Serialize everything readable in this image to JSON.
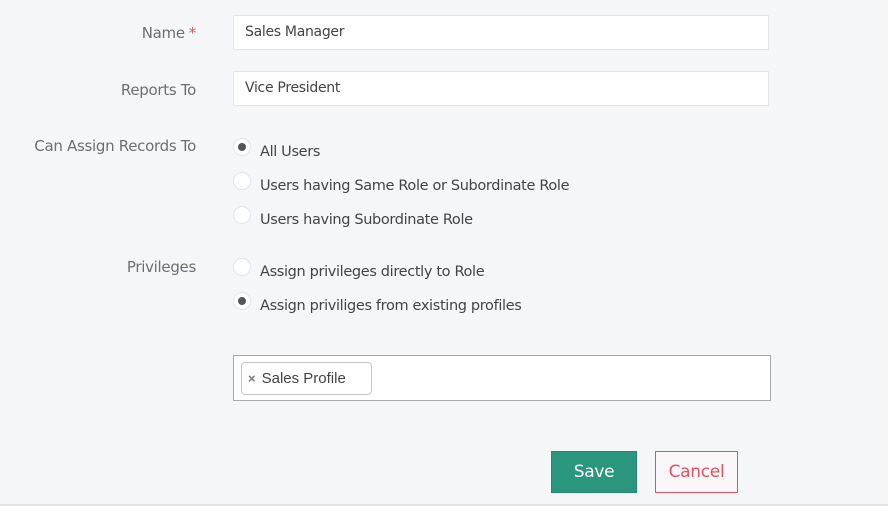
{
  "form": {
    "name": {
      "label": "Name",
      "required_marker": "*",
      "value": "Sales Manager"
    },
    "reports_to": {
      "label": "Reports To",
      "value": "Vice President"
    },
    "can_assign": {
      "label": "Can Assign Records To",
      "options": [
        {
          "label": "All Users",
          "selected": true
        },
        {
          "label": "Users having Same Role or Subordinate Role",
          "selected": false
        },
        {
          "label": "Users having Subordinate Role",
          "selected": false
        }
      ]
    },
    "privileges": {
      "label": "Privileges",
      "options": [
        {
          "label": "Assign privileges directly to Role",
          "selected": false
        },
        {
          "label": "Assign priviliges from existing profiles",
          "selected": true
        }
      ]
    },
    "profiles": {
      "tags": [
        {
          "label": "Sales Profile",
          "remove_icon": "×"
        }
      ]
    }
  },
  "actions": {
    "save_label": "Save",
    "cancel_label": "Cancel"
  }
}
